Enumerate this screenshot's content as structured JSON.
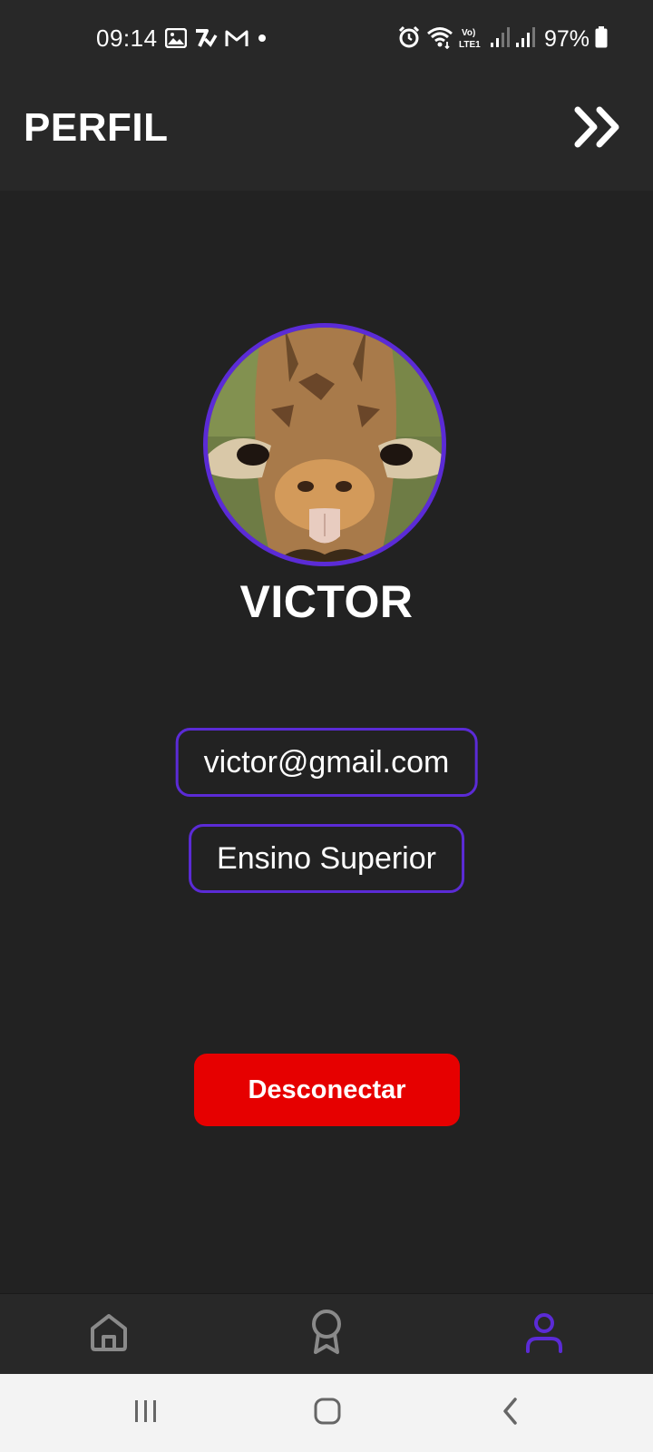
{
  "status_bar": {
    "time": "09:14",
    "battery": "97%",
    "left_icons": [
      "gallery-icon",
      "app-notification-icon",
      "gmail-icon",
      "dot-icon"
    ],
    "right_icons": [
      "alarm-icon",
      "wifi-icon",
      "volte-icon",
      "signal-icon",
      "signal-icon",
      "battery-icon"
    ]
  },
  "header": {
    "title": "PERFIL",
    "forward_icon": "double-chevron-right-icon"
  },
  "profile": {
    "name": "VICTOR",
    "email": "victor@gmail.com",
    "education": "Ensino Superior",
    "avatar": "giraffe-photo"
  },
  "actions": {
    "disconnect_label": "Desconectar"
  },
  "bottom_nav": {
    "items": [
      {
        "icon": "home-icon",
        "active": false
      },
      {
        "icon": "award-icon",
        "active": false
      },
      {
        "icon": "user-icon",
        "active": true
      }
    ]
  },
  "colors": {
    "background": "#222222",
    "header": "#282828",
    "accent": "#5b2bd6",
    "danger": "#e60000",
    "inactive_icon": "#8a8a8a"
  }
}
